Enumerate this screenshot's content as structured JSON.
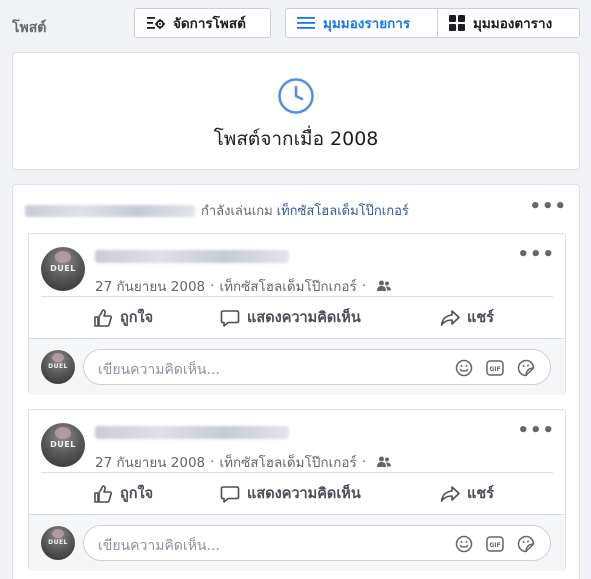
{
  "header": {
    "title": "โพสต์",
    "manage_label": "จัดการโพสต์",
    "list_view_label": "มุมมองรายการ",
    "grid_view_label": "มุมมองตาราง"
  },
  "year_card": {
    "title": "โพสต์จากเมื่อ 2008"
  },
  "feed": {
    "activity_text": "กำลังเล่นเกม",
    "game_name": "เท็กซัสโฮลเด็มโป๊กเกอร์"
  },
  "posts": [
    {
      "avatar_text": "DUEL",
      "date": "27 กันยายน 2008",
      "app": "เท็กซัสโฮลเด็มโป๊กเกอร์",
      "like_label": "ถูกใจ",
      "comment_label": "แสดงความคิดเห็น",
      "share_label": "แชร์",
      "comment_placeholder": "เขียนความคิดเห็น..."
    },
    {
      "avatar_text": "DUEL",
      "date": "27 กันยายน 2008",
      "app": "เท็กซัสโฮลเด็มโป๊กเกอร์",
      "like_label": "ถูกใจ",
      "comment_label": "แสดงความคิดเห็น",
      "share_label": "แชร์",
      "comment_placeholder": "เขียนความคิดเห็น..."
    }
  ],
  "colors": {
    "accent": "#1877f2",
    "link": "#385898",
    "background": "#f0f2f5"
  }
}
